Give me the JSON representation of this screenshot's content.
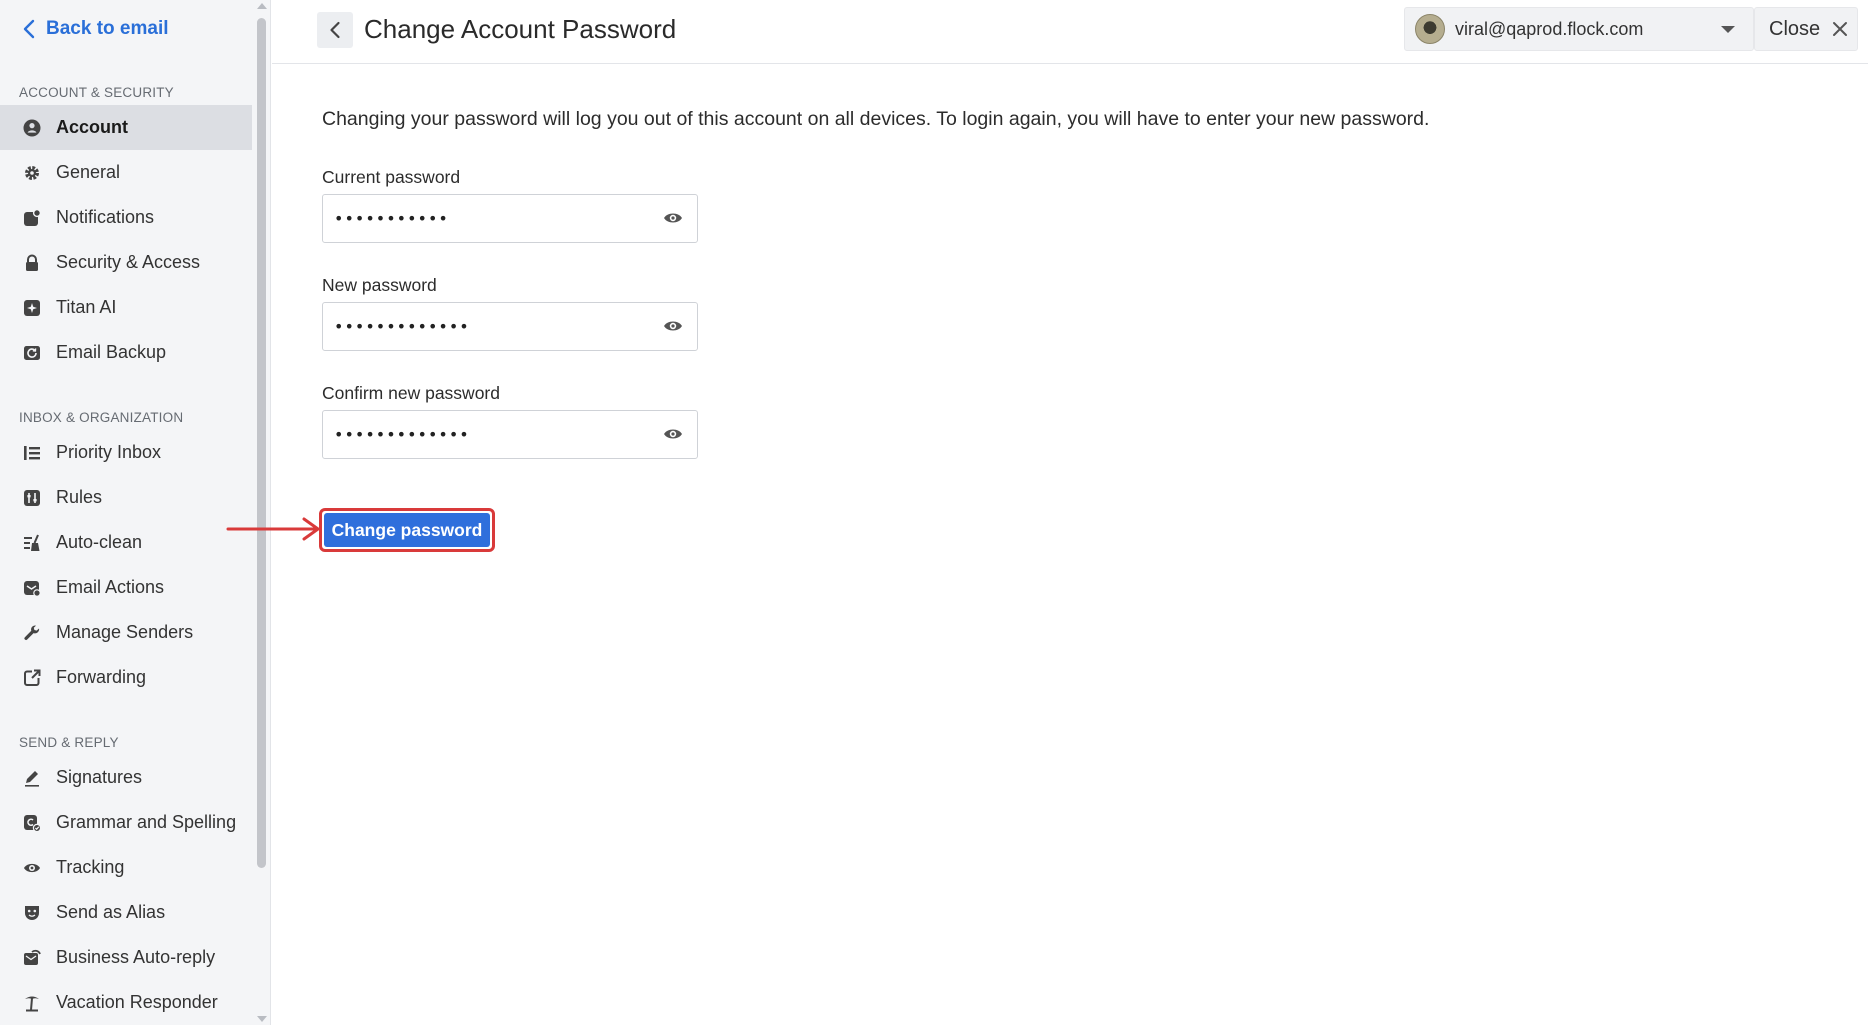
{
  "sidebar": {
    "back_label": "Back to email",
    "sections": [
      {
        "heading": "ACCOUNT & SECURITY",
        "items": [
          {
            "label": "Account",
            "icon": "user-circle-icon",
            "active": true
          },
          {
            "label": "General",
            "icon": "gear-icon"
          },
          {
            "label": "Notifications",
            "icon": "notification-icon"
          },
          {
            "label": "Security & Access",
            "icon": "lock-icon"
          },
          {
            "label": "Titan AI",
            "icon": "sparkle-icon"
          },
          {
            "label": "Email Backup",
            "icon": "backup-icon"
          }
        ]
      },
      {
        "heading": "INBOX & ORGANIZATION",
        "items": [
          {
            "label": "Priority Inbox",
            "icon": "priority-list-icon"
          },
          {
            "label": "Rules",
            "icon": "rules-icon"
          },
          {
            "label": "Auto-clean",
            "icon": "broom-icon"
          },
          {
            "label": "Email Actions",
            "icon": "email-actions-icon"
          },
          {
            "label": "Manage Senders",
            "icon": "wrench-icon"
          },
          {
            "label": "Forwarding",
            "icon": "forward-icon"
          }
        ]
      },
      {
        "heading": "SEND & REPLY",
        "items": [
          {
            "label": "Signatures",
            "icon": "pen-icon"
          },
          {
            "label": "Grammar and Spelling",
            "icon": "grammar-icon"
          },
          {
            "label": "Tracking",
            "icon": "eye-icon"
          },
          {
            "label": "Send as Alias",
            "icon": "mask-icon"
          },
          {
            "label": "Business Auto-reply",
            "icon": "auto-reply-icon"
          },
          {
            "label": "Vacation Responder",
            "icon": "palm-tree-icon"
          }
        ]
      }
    ]
  },
  "header": {
    "title": "Change Account Password",
    "account_email": "viral@qaprod.flock.com",
    "close_label": "Close"
  },
  "form": {
    "info": "Changing your password will log you out of this account on all devices. To login again, you will have to enter your new password.",
    "current_label": "Current password",
    "current_value": "•••••••••••",
    "new_label": "New password",
    "new_value": "•••••••••••••",
    "confirm_label": "Confirm new password",
    "confirm_value": "•••••••••••••",
    "submit_label": "Change password"
  },
  "colors": {
    "accent": "#2f6fdc",
    "link": "#2a6fd8",
    "annotation": "#d93a3a",
    "active_bg": "#dcdee3"
  }
}
